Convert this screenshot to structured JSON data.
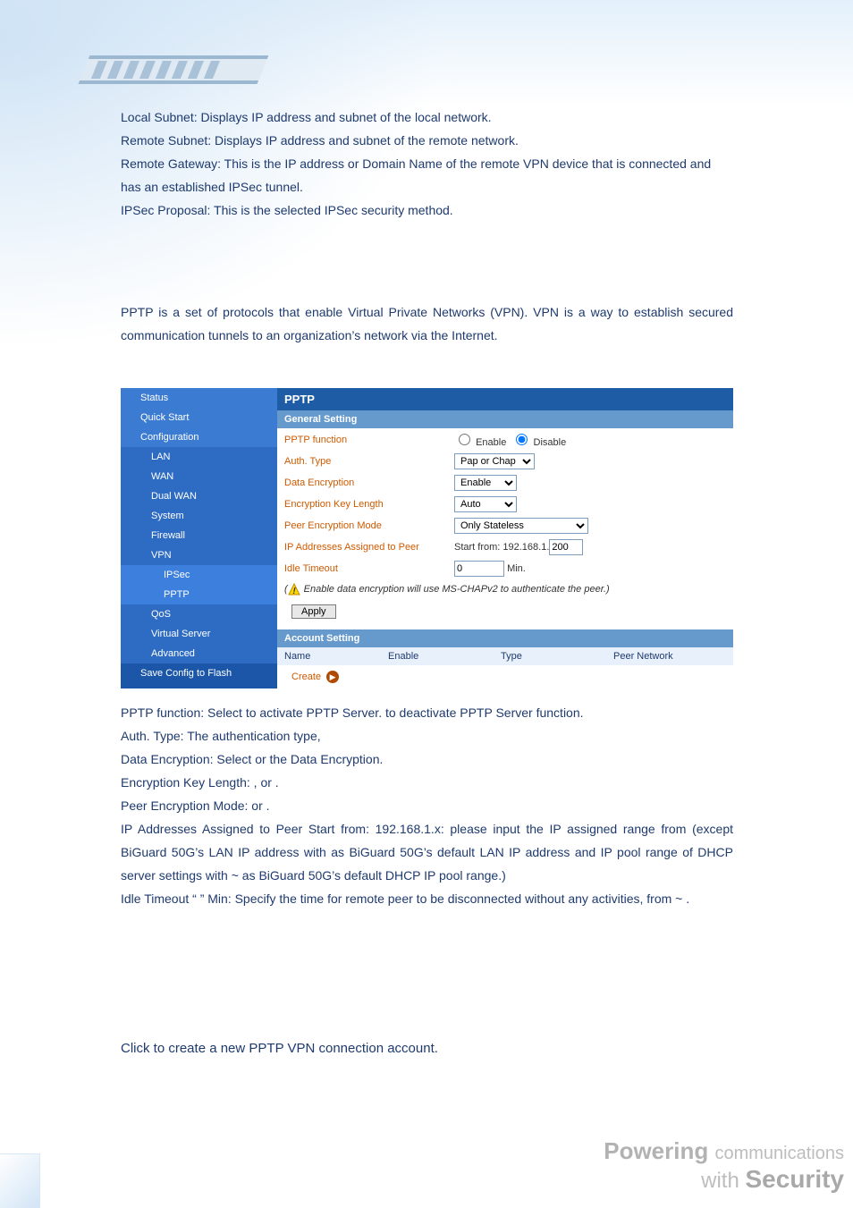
{
  "text": {
    "t_local": "Local Subnet: Displays IP address and subnet of the local network.",
    "t_remote": "Remote Subnet: Displays IP address and subnet of the remote network.",
    "t_gw1": "Remote Gateway: This is the IP address or Domain Name of the remote VPN device that is connected and has an established IPSec tunnel.",
    "t_prop": "IPSec Proposal: This is the selected IPSec security method.",
    "pptp_intro": "PPTP is a set of protocols that enable Virtual Private Networks (VPN). VPN is a way to establish secured communication tunnels to an organization’s network via the Internet.",
    "t_pf1": "PPTP function: Select ",
    "t_pf2": " to activate PPTP Server. ",
    "t_pf3": " to deactivate PPTP Server function.",
    "t_auth": "Auth. Type: The authentication type,",
    "t_de1": "Data Encryption: Select ",
    "t_de2": " or ",
    "t_de3": " the Data Encryption.",
    "t_ek1": "Encryption Key Length: ",
    "t_ek2": ", ",
    "t_ek3": " or ",
    "t_ek4": ".",
    "t_pe1": "Peer Encryption Mode: ",
    "t_pe2": " or ",
    "t_pe3": ".",
    "t_ip": "IP Addresses Assigned to Peer Start from: 192.168.1.x: please input the IP assigned range from ",
    "t_ip2": " (except BiGuard 50G’s LAN IP address with ",
    "t_ip3": " as BiGuard 50G’s default LAN IP address and IP pool range of DHCP server settings with ",
    "t_ip4": " ~ ",
    "t_ip5": " as BiGuard 50G’s default DHCP IP pool range.)",
    "t_idle": "Idle Timeout “   ” Min: Specify the time for remote peer to be disconnected without any activities, from ",
    "t_idle2": " ~ ",
    "t_idle3": ".",
    "t_create": "Click ",
    "t_create2": " to create a new PPTP VPN connection account."
  },
  "sidebar": {
    "items": [
      {
        "label": "Status",
        "cls": "sb-top"
      },
      {
        "label": "Quick Start",
        "cls": "sb-top"
      },
      {
        "label": "Configuration",
        "cls": "sb-top"
      },
      {
        "label": "LAN",
        "cls": "sb-sub"
      },
      {
        "label": "WAN",
        "cls": "sb-sub"
      },
      {
        "label": "Dual WAN",
        "cls": "sb-sub"
      },
      {
        "label": "System",
        "cls": "sb-sub"
      },
      {
        "label": "Firewall",
        "cls": "sb-sub"
      },
      {
        "label": "VPN",
        "cls": "sb-sub"
      },
      {
        "label": "IPSec",
        "cls": "sb-sub2"
      },
      {
        "label": "PPTP",
        "cls": "sb-sub2"
      },
      {
        "label": "QoS",
        "cls": "sb-sub"
      },
      {
        "label": "Virtual Server",
        "cls": "sb-sub"
      },
      {
        "label": "Advanced",
        "cls": "sb-sub"
      },
      {
        "label": "Save Config to Flash",
        "cls": "sb-save"
      }
    ]
  },
  "ui": {
    "title": "PPTP",
    "gen": "General Setting",
    "rows": {
      "func": {
        "label": "PPTP function",
        "enable": "Enable",
        "disable": "Disable"
      },
      "auth": {
        "label": "Auth. Type",
        "value": "Pap or Chap"
      },
      "dataenc": {
        "label": "Data Encryption",
        "value": "Enable"
      },
      "ekey": {
        "label": "Encryption Key Length",
        "value": "Auto"
      },
      "peer": {
        "label": "Peer Encryption Mode",
        "value": "Only Stateless"
      },
      "ipaddr": {
        "label": "IP Addresses Assigned to Peer",
        "prefix": "Start from: 192.168.1.",
        "value": "200"
      },
      "idle": {
        "label": "Idle Timeout",
        "value": "0",
        "unit": "Min."
      }
    },
    "note": "Enable data encryption will use MS-CHAPv2 to authenticate the peer.",
    "apply": "Apply",
    "acct": "Account Setting",
    "acct_cols": {
      "c1": "Name",
      "c2": "Enable",
      "c3": "Type",
      "c4": "Peer Network"
    },
    "create": "Create"
  },
  "tagline": {
    "l1a": "Powering",
    "l1b": "communications",
    "l2a": "with",
    "l2b": "Security"
  }
}
